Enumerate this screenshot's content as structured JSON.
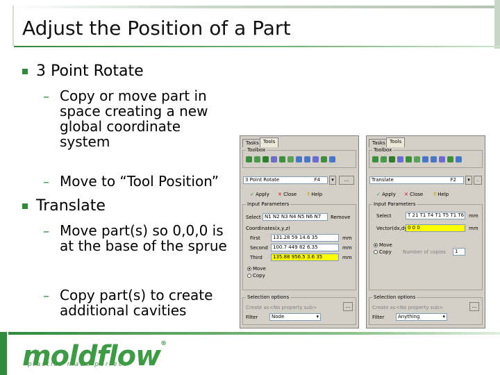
{
  "slide": {
    "title": "Adjust the Position of a Part",
    "bullets": [
      {
        "text": "3 Point Rotate",
        "subs": [
          "Copy or move part in space creating a new global coordinate system",
          "Move to “Tool Position”"
        ]
      },
      {
        "text": "Translate",
        "subs": [
          "Move part(s) so 0,0,0 is at the base of the sprue",
          "Copy part(s) to create additional cavities"
        ]
      }
    ],
    "sub_dash": "–",
    "logo_text": "moldflow",
    "logo_reg": "®",
    "tagline": "plastics made perfect"
  },
  "colors": {
    "accent": "#2f8a3b",
    "dialog_bg": "#d4d0c8",
    "highlight": "#ffff00"
  },
  "panel_rotate": {
    "tabs": [
      "Tasks",
      "Tools"
    ],
    "toolbox_label": "Toolbox",
    "tool_select": "3 Point Rotate",
    "tool_shortcut": "F4",
    "tool_more": "...",
    "apply": "Apply",
    "close": "Close",
    "help": "Help",
    "input_params_label": "Input Parameters",
    "select_label": "Select",
    "select_value": "N1 N2 N3 N4 N5 N6 N7",
    "remove": "Remove",
    "coords_label": "Coordinates(x,y,z)",
    "first_label": "First",
    "first_value": "131.28 59 14.6 35",
    "second_label": "Second",
    "second_value": "100.7 449 82 6.35",
    "third_label": "Third",
    "third_value": "135.88 956.5 3.6 35",
    "unit": "mm",
    "move_label": "Move",
    "copy_label": "Copy",
    "selection_options_label": "Selection options",
    "create_as_label": "Create as",
    "create_as_value": "<No property sub>",
    "filter_label": "Filter",
    "filter_value": "Node",
    "more_btn": "..."
  },
  "panel_translate": {
    "tabs": [
      "Tasks",
      "Tools"
    ],
    "toolbox_label": "Toolbox",
    "tool_select": "Translate",
    "tool_shortcut": "F2",
    "apply": "Apply",
    "close": "Close",
    "help": "Help",
    "input_params_label": "Input Parameters",
    "select_label": "Select",
    "select_value": "T 21 T1 T4 T1 T5 T1 T6",
    "vector_label": "Vector(dx,dy,dz)",
    "vector_value": "0 0 0",
    "unit": "mm",
    "move_label": "Move",
    "copy_label": "Copy",
    "copies_label": "Number of copies",
    "copies_value": "1",
    "selection_options_label": "Selection options",
    "create_as_label": "Create as",
    "create_as_value": "<No property sub>",
    "filter_label": "Filter",
    "filter_value": "Anything",
    "more_btn": "..."
  }
}
